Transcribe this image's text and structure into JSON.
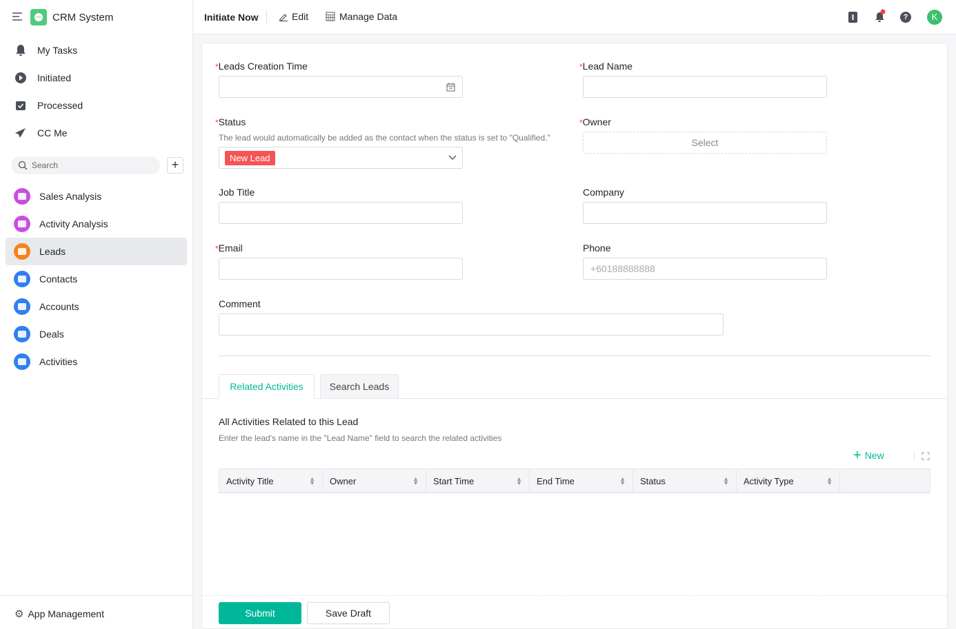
{
  "app": {
    "title": "CRM System",
    "logo_text": "CRM"
  },
  "sidebar": {
    "items": [
      {
        "label": "My Tasks"
      },
      {
        "label": "Initiated"
      },
      {
        "label": "Processed"
      },
      {
        "label": "CC Me"
      }
    ],
    "search_placeholder": "Search",
    "apps": [
      {
        "label": "Sales Analysis",
        "color": "#c94fe0"
      },
      {
        "label": "Activity Analysis",
        "color": "#c94fe0"
      },
      {
        "label": "Leads",
        "color": "#f7821b"
      },
      {
        "label": "Contacts",
        "color": "#2f7ff0"
      },
      {
        "label": "Accounts",
        "color": "#2f7ff0"
      },
      {
        "label": "Deals",
        "color": "#2f7ff0"
      },
      {
        "label": "Activities",
        "color": "#2f7ff0"
      }
    ],
    "footer": "App Management"
  },
  "topbar": {
    "title": "Initiate Now",
    "edit": "Edit",
    "manage": "Manage Data",
    "avatar": "K"
  },
  "form": {
    "creation_time": {
      "label": "Leads Creation Time"
    },
    "lead_name": {
      "label": "Lead Name"
    },
    "status": {
      "label": "Status",
      "hint": "The lead would automatically be added as the contact when the status is set to \"Qualified.\"",
      "value": "New Lead"
    },
    "owner": {
      "label": "Owner",
      "placeholder": "Select"
    },
    "job_title": {
      "label": "Job Title"
    },
    "company": {
      "label": "Company"
    },
    "email": {
      "label": "Email"
    },
    "phone": {
      "label": "Phone",
      "placeholder": "+60188888888"
    },
    "comment": {
      "label": "Comment"
    }
  },
  "tabs": [
    {
      "label": "Related Activities"
    },
    {
      "label": "Search Leads"
    }
  ],
  "activities": {
    "title": "All Activities Related to this Lead",
    "hint": "Enter the lead's name in the \"Lead Name\" field to search the related activities",
    "new": "New",
    "columns": [
      "Activity Title",
      "Owner",
      "Start Time",
      "End Time",
      "Status",
      "Activity Type"
    ]
  },
  "actions": {
    "submit": "Submit",
    "draft": "Save Draft"
  },
  "colors": {
    "accent": "#00b899",
    "danger": "#f55454"
  }
}
